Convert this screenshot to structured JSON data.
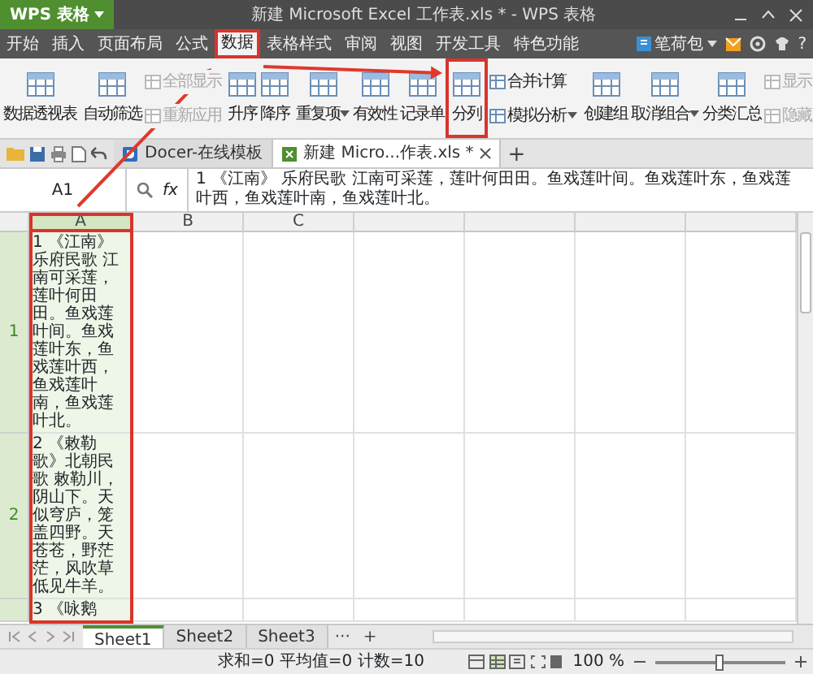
{
  "window": {
    "app_button": "WPS 表格",
    "title": "新建 Microsoft Excel 工作表.xls * - WPS 表格"
  },
  "menu_tabs": [
    {
      "label": "开始",
      "selected": false,
      "annotated": false
    },
    {
      "label": "插入",
      "selected": false,
      "annotated": false
    },
    {
      "label": "页面布局",
      "selected": false,
      "annotated": false
    },
    {
      "label": "公式",
      "selected": false,
      "annotated": false
    },
    {
      "label": "数据",
      "selected": true,
      "annotated": true
    },
    {
      "label": "表格样式",
      "selected": false,
      "annotated": false
    },
    {
      "label": "审阅",
      "selected": false,
      "annotated": false
    },
    {
      "label": "视图",
      "selected": false,
      "annotated": false
    },
    {
      "label": "开发工具",
      "selected": false,
      "annotated": false
    },
    {
      "label": "特色功能",
      "selected": false,
      "annotated": false
    }
  ],
  "menu_right": {
    "label": "笔荷包",
    "help": "?"
  },
  "ribbon": [
    {
      "items": [
        {
          "kind": "large",
          "label": "数据透视表",
          "dropdown": false,
          "annotated": false
        }
      ]
    },
    {
      "items": [
        {
          "kind": "large",
          "label": "自动筛选",
          "dropdown": false,
          "annotated": false
        },
        {
          "kind": "stack",
          "entries": [
            {
              "label": "全部显示",
              "disabled": true,
              "dropdown": false
            },
            {
              "label": "重新应用",
              "disabled": true,
              "dropdown": false
            }
          ]
        }
      ]
    },
    {
      "items": [
        {
          "kind": "large",
          "label": "升序",
          "dropdown": false,
          "annotated": false
        },
        {
          "kind": "large",
          "label": "降序",
          "dropdown": false,
          "annotated": false
        }
      ]
    },
    {
      "items": [
        {
          "kind": "large",
          "label": "重复项",
          "dropdown": true,
          "annotated": false
        },
        {
          "kind": "large",
          "label": "有效性",
          "dropdown": false,
          "annotated": false
        },
        {
          "kind": "large",
          "label": "记录单",
          "dropdown": false,
          "annotated": false
        },
        {
          "kind": "large",
          "label": "分列",
          "dropdown": false,
          "annotated": true
        },
        {
          "kind": "stack",
          "entries": [
            {
              "label": "合并计算",
              "disabled": false,
              "dropdown": false
            },
            {
              "label": "模拟分析",
              "disabled": false,
              "dropdown": true
            }
          ]
        }
      ]
    },
    {
      "items": [
        {
          "kind": "large",
          "label": "创建组",
          "dropdown": false,
          "annotated": false
        },
        {
          "kind": "large",
          "label": "取消组合",
          "dropdown": true,
          "annotated": false
        },
        {
          "kind": "large",
          "label": "分类汇总",
          "dropdown": false,
          "annotated": false
        },
        {
          "kind": "stack",
          "entries": [
            {
              "label": "显示",
              "disabled": true,
              "dropdown": false
            },
            {
              "label": "隐藏",
              "disabled": true,
              "dropdown": false
            }
          ]
        }
      ]
    }
  ],
  "doc_tabs": [
    {
      "label": "Docer-在线模板",
      "selected": false,
      "closable": false
    },
    {
      "label": "新建 Micro...作表.xls *",
      "selected": true,
      "closable": true
    }
  ],
  "doc_tab_add": "+",
  "formula_bar": {
    "name_box": "A1",
    "fx": "fx",
    "formula": "1 《江南》 乐府民歌 江南可采莲，莲叶何田田。鱼戏莲叶间。鱼戏莲叶东，鱼戏莲叶西，鱼戏莲叶南，鱼戏莲叶北。"
  },
  "grid": {
    "columns": [
      {
        "header": "A",
        "selected": true,
        "annotated": true
      },
      {
        "header": "B",
        "selected": false
      },
      {
        "header": "C",
        "selected": false
      }
    ],
    "rows": [
      {
        "header": "1",
        "cells": [
          "1 《江南》乐府民歌 江南可采莲，莲叶何田田。鱼戏莲叶间。鱼戏莲叶东，鱼戏莲叶西，鱼戏莲叶南，鱼戏莲叶北。"
        ]
      },
      {
        "header": "2",
        "cells": [
          "2 《敕勒歌》北朝民歌 敕勒川，阴山下。天似穹庐，笼盖四野。天苍苍，野茫茫，风吹草低见牛羊。"
        ]
      },
      {
        "cells": [
          "3 《咏鹅"
        ]
      }
    ]
  },
  "sheet_tabs": [
    {
      "label": "Sheet1",
      "selected": true
    },
    {
      "label": "Sheet2",
      "selected": false
    },
    {
      "label": "Sheet3",
      "selected": false
    }
  ],
  "sheet_more": "···",
  "sheet_add": "+",
  "status_bar": {
    "summary": "求和=0 平均值=0 计数=10",
    "zoom": "100 %",
    "zoom_level": {
      "level": 0.5
    }
  }
}
